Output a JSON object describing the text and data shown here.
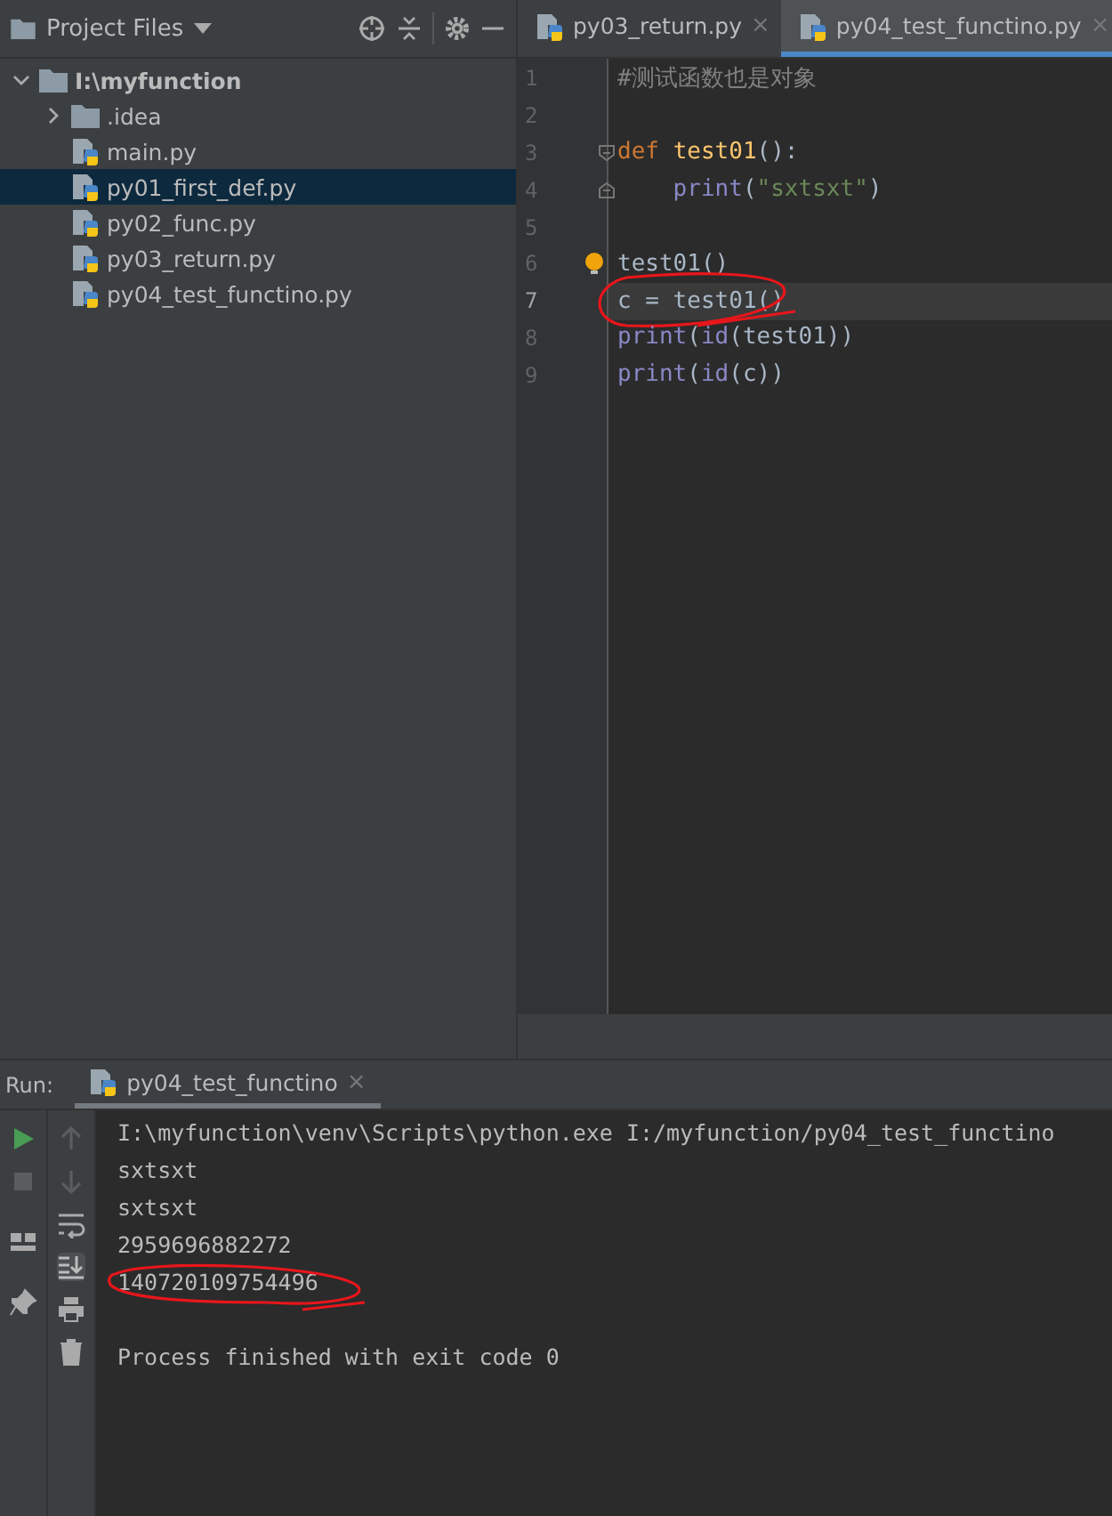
{
  "project": {
    "title": "Project Files",
    "tree": [
      {
        "label": "I:\\myfunction",
        "kind": "folder",
        "expanded": true,
        "selected": false,
        "children": [
          {
            "label": ".idea",
            "kind": "folder",
            "expanded": false,
            "selected": false
          },
          {
            "label": "main.py",
            "kind": "python",
            "selected": false
          },
          {
            "label": "py01_first_def.py",
            "kind": "python",
            "selected": true
          },
          {
            "label": "py02_func.py",
            "kind": "python",
            "selected": false
          },
          {
            "label": "py03_return.py",
            "kind": "python",
            "selected": false
          },
          {
            "label": "py04_test_functino.py",
            "kind": "python",
            "selected": false
          }
        ]
      }
    ]
  },
  "editor": {
    "tabs": [
      {
        "label": "py03_return.py",
        "close": "×",
        "selected": false
      },
      {
        "label": "py04_test_functino.py",
        "close": "×",
        "selected": true
      }
    ],
    "lines": [
      {
        "number": "1",
        "tokens": [
          {
            "kind": "comment",
            "text": "#测试函数也是对象"
          }
        ]
      },
      {
        "number": "2"
      },
      {
        "number": "3",
        "fold_open": true,
        "tokens": [
          {
            "kind": "keyword",
            "text": "def "
          },
          {
            "kind": "function",
            "text": "test01"
          },
          {
            "kind": "plain",
            "text": "():"
          }
        ]
      },
      {
        "number": "4",
        "fold_close": true,
        "tokens": [
          {
            "kind": "builtin",
            "text": "    print"
          },
          {
            "kind": "plain",
            "text": "("
          },
          {
            "kind": "string",
            "text": "\"sxtsxt\""
          },
          {
            "kind": "plain",
            "text": ")"
          }
        ]
      },
      {
        "number": "5"
      },
      {
        "number": "6",
        "bulb": true,
        "tokens": [
          {
            "kind": "plain",
            "text": "test01()"
          }
        ]
      },
      {
        "number": "7",
        "current": true,
        "circled": true,
        "tokens": [
          {
            "kind": "plain",
            "text": "c = test01()"
          }
        ]
      },
      {
        "number": "8",
        "tokens": [
          {
            "kind": "builtin",
            "text": "print"
          },
          {
            "kind": "plain",
            "text": "("
          },
          {
            "kind": "builtin",
            "text": "id"
          },
          {
            "kind": "plain",
            "text": "(test01))"
          }
        ]
      },
      {
        "number": "9",
        "tokens": [
          {
            "kind": "builtin",
            "text": "print"
          },
          {
            "kind": "plain",
            "text": "("
          },
          {
            "kind": "builtin",
            "text": "id"
          },
          {
            "kind": "plain",
            "text": "(c))"
          }
        ]
      }
    ]
  },
  "run": {
    "label": "Run:",
    "tabs": [
      {
        "label": "py04_test_functino",
        "close": "×",
        "selected": true
      }
    ],
    "output": [
      {
        "kind": "line",
        "text": "I:\\myfunction\\venv\\Scripts\\python.exe I:/myfunction/py04_test_functino"
      },
      {
        "kind": "line",
        "text": "sxtsxt"
      },
      {
        "kind": "line",
        "text": "sxtsxt"
      },
      {
        "kind": "line",
        "text": "2959696882272"
      },
      {
        "kind": "line",
        "text": "140720109754496",
        "circled": true
      },
      {
        "kind": "status",
        "text": "Process finished with exit code 0"
      }
    ]
  }
}
